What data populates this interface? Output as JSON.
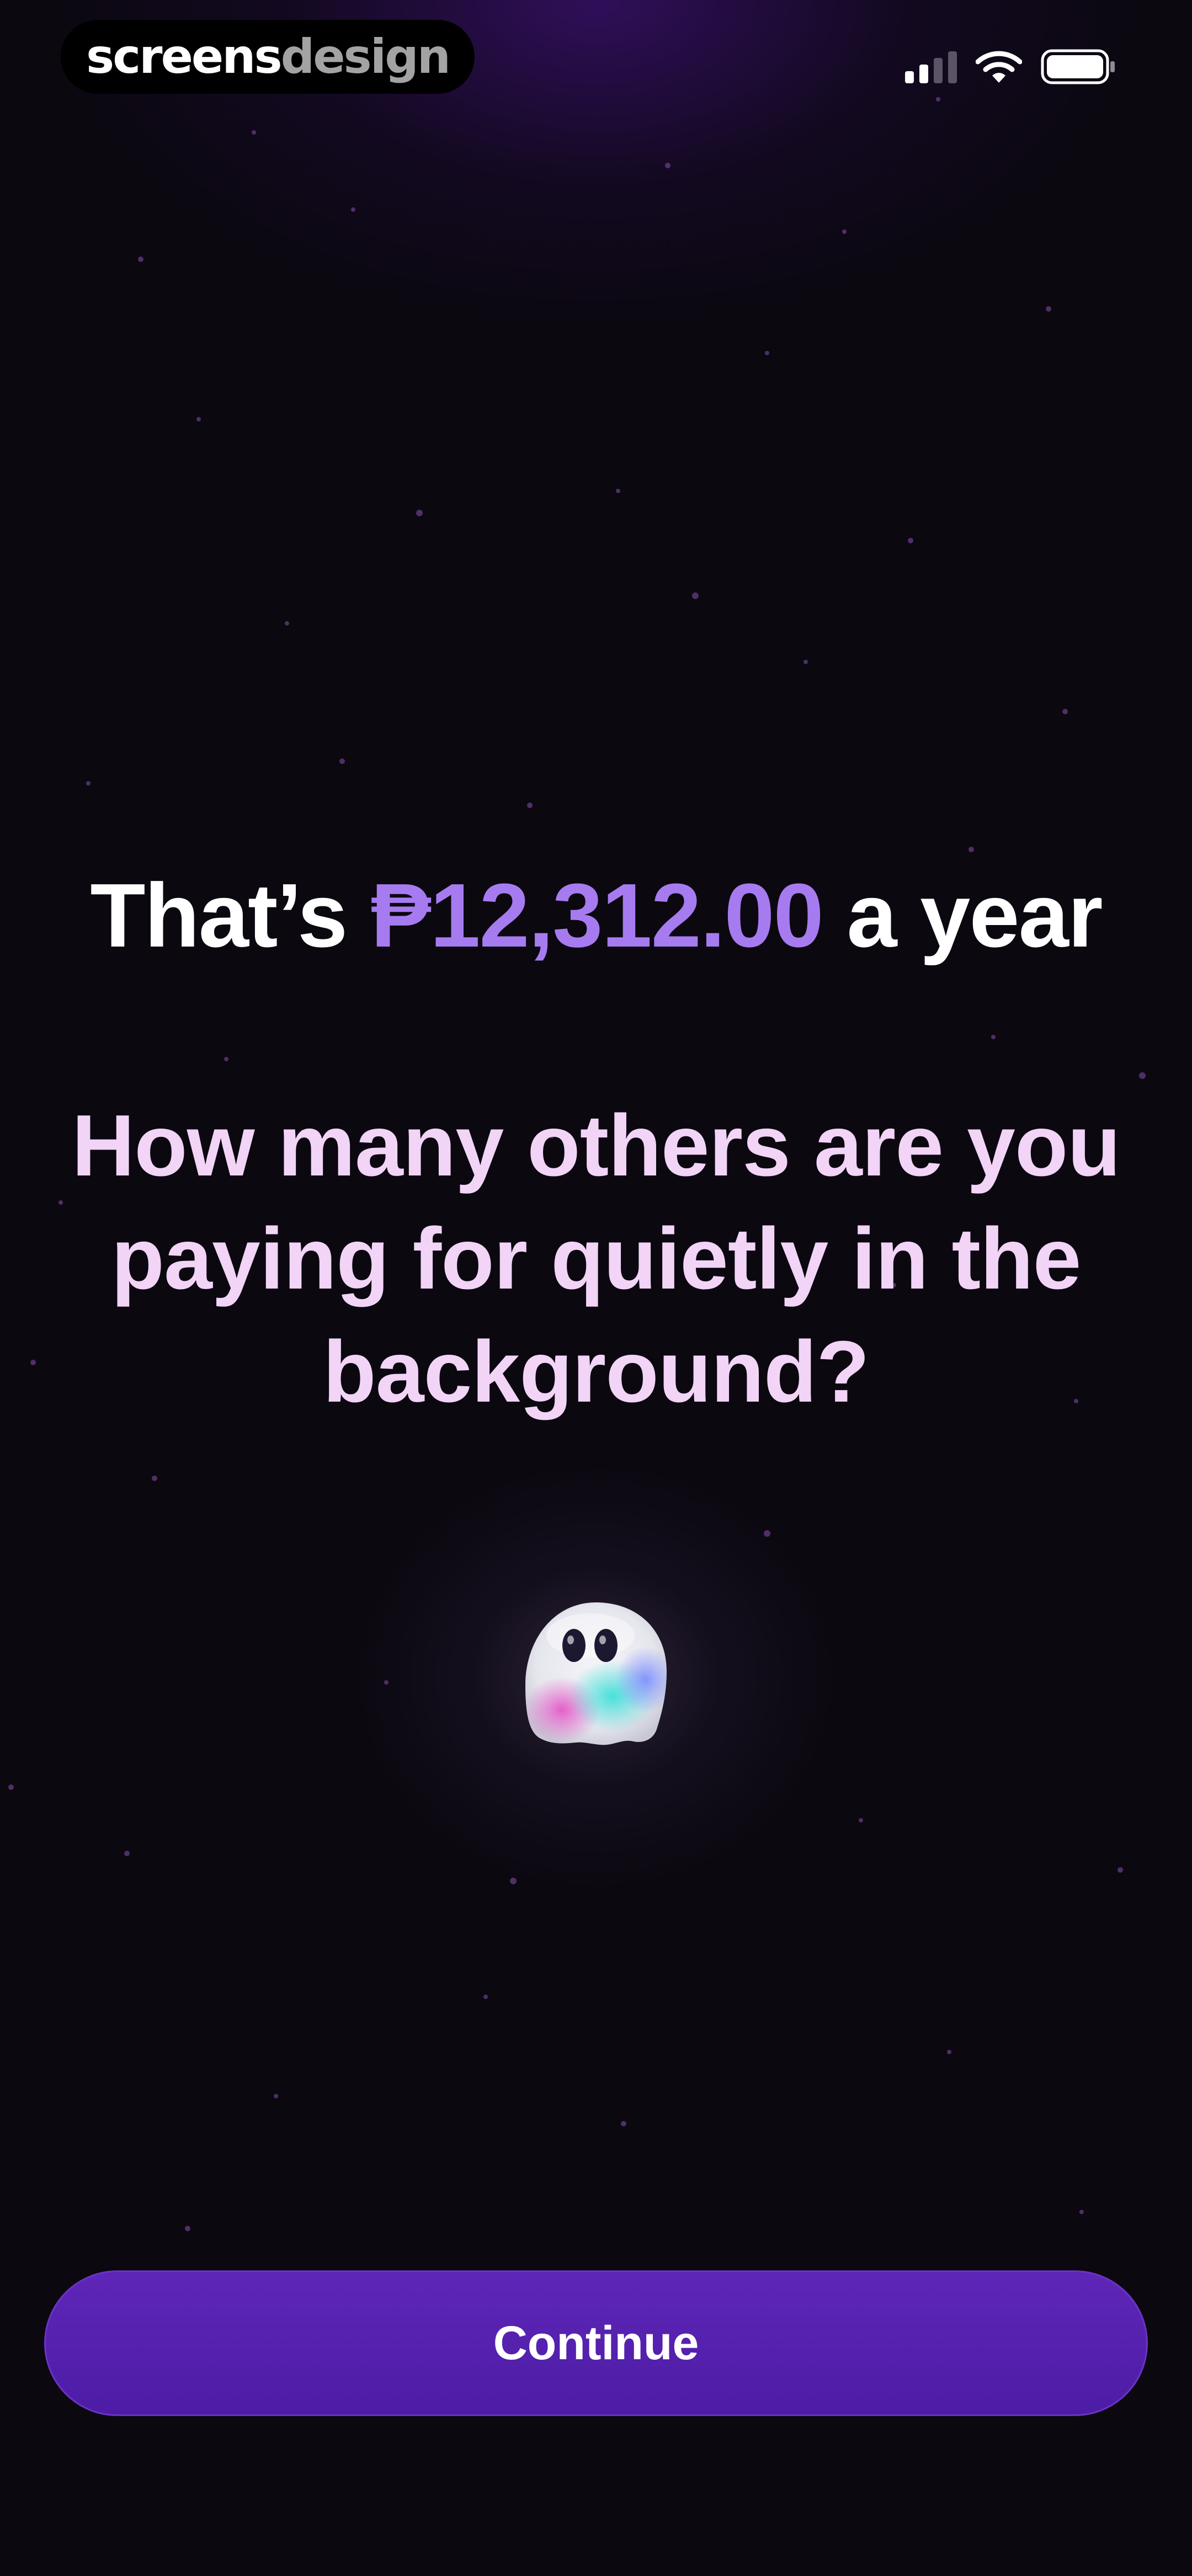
{
  "status_bar": {
    "brand_part1": "screens",
    "brand_part2": "design",
    "signal_icon": "cellular-signal-icon",
    "wifi_icon": "wifi-icon",
    "battery_icon": "battery-icon"
  },
  "headline": {
    "prefix": "That’s ",
    "amount": "₱12,312.00",
    "suffix": " a year"
  },
  "question": "How many others are you paying for quietly in the background?",
  "mascot": {
    "icon": "ghost-icon"
  },
  "continue_button": {
    "label": "Continue"
  },
  "colors": {
    "background": "#0b0810",
    "accent_amount": "#a77bf0",
    "question_text": "#f2d4f7",
    "button": "#5a22b4"
  }
}
